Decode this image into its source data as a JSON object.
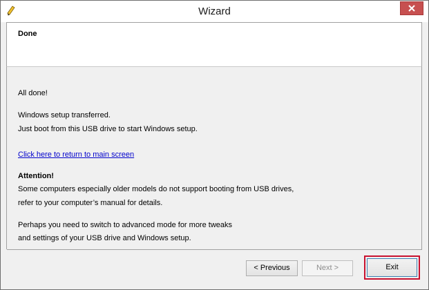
{
  "window": {
    "title": "Wizard",
    "app_icon": "pencil-icon",
    "close_icon": "close-icon",
    "close_color": "#c75050"
  },
  "header": {
    "title": "Done"
  },
  "content": {
    "all_done": "All done!",
    "transferred": "Windows setup transferred.",
    "boot_hint": "Just boot from this USB drive to start Windows setup.",
    "return_link": "Click here to return to main screen",
    "attention_title": "Attention!",
    "attention_line1": "Some computers especially older models do not support booting from USB drives,",
    "attention_line2": "refer to your computer’s manual for details.",
    "advanced_line1": "Perhaps you need to switch to advanced mode for more tweaks",
    "advanced_line2": "and settings of your USB drive and Windows setup."
  },
  "footer": {
    "previous_label": "< Previous",
    "next_label": "Next >",
    "exit_label": "Exit",
    "highlight_color": "#c8102e"
  }
}
